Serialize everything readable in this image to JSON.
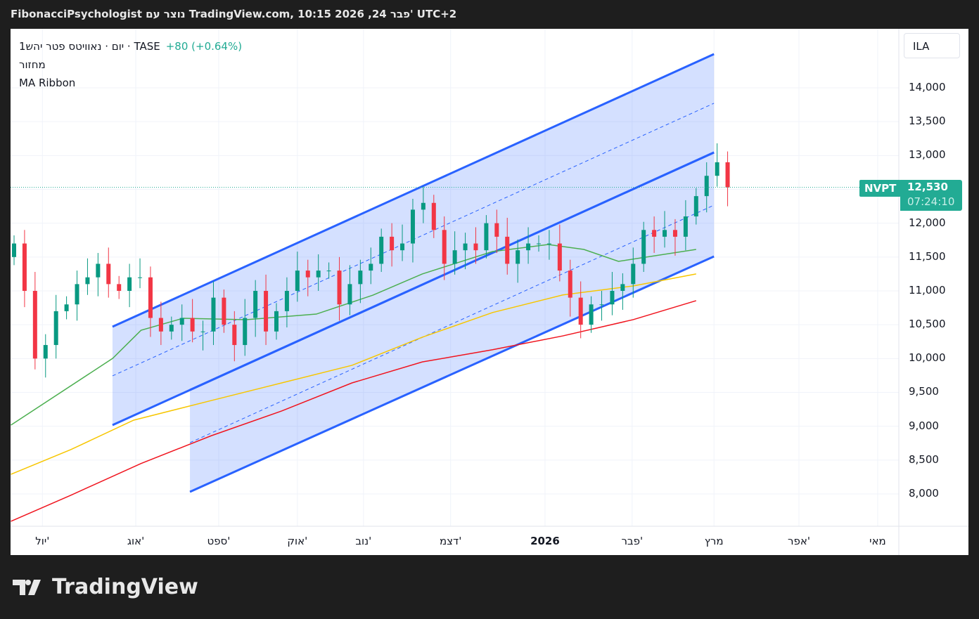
{
  "header": {
    "title": "FibonacciPsychologist נוצר עם TradingView.com, 10:15 2026 ,24 פבר' UTC+2"
  },
  "legend": {
    "symbol": "1יום · נאוויטס פטר יהש · TASE",
    "change": "+80 (+0.64%)",
    "indicator1": "מחזור",
    "indicator2": "MA Ribbon"
  },
  "currency": "ILA",
  "price_tag": {
    "symbol": "NVPT",
    "price": "12,530",
    "countdown": "07:24:10"
  },
  "brand": "TradingView",
  "colors": {
    "up": "#089981",
    "down": "#f23645",
    "ma1": "#4caf50",
    "ma2": "#f7c600",
    "ma3": "#f0141e",
    "channel": "#2962ff",
    "fill": "rgba(41,98,255,0.2)",
    "last": "#22ab94"
  },
  "chart_data": {
    "type": "candlestick",
    "title": "נאוויטס פטר יהש · 1יום · TASE",
    "ylim": [
      7600,
      14800
    ],
    "y_ticks": [
      "8,000",
      "8,500",
      "9,000",
      "9,500",
      "10,000",
      "10,500",
      "11,000",
      "11,500",
      "12,000",
      "12,500",
      "13,000",
      "13,500",
      "14,000"
    ],
    "y_tick_values": [
      8000,
      8500,
      9000,
      9500,
      10000,
      10500,
      11000,
      11500,
      12000,
      12500,
      13000,
      13500,
      14000
    ],
    "x_ticks": [
      {
        "label": "יול'",
        "i": 2.7,
        "bold": false
      },
      {
        "label": "אוג'",
        "i": 11.6,
        "bold": false
      },
      {
        "label": "ספט'",
        "i": 19.5,
        "bold": false
      },
      {
        "label": "אוק'",
        "i": 27.0,
        "bold": false
      },
      {
        "label": "נוב'",
        "i": 33.3,
        "bold": false
      },
      {
        "label": "דצמ'",
        "i": 41.6,
        "bold": false
      },
      {
        "label": "2026",
        "i": 50.6,
        "bold": true
      },
      {
        "label": "פבר'",
        "i": 58.9,
        "bold": false
      },
      {
        "label": "מרץ",
        "i": 66.7,
        "bold": false
      },
      {
        "label": "אפר'",
        "i": 74.8,
        "bold": false
      },
      {
        "label": "מאי",
        "i": 82.3,
        "bold": false
      }
    ],
    "closes": [
      11700,
      11000,
      10000,
      10200,
      10700,
      10800,
      11100,
      11200,
      11400,
      11100,
      11000,
      11200,
      11200,
      10600,
      10400,
      10500,
      10600,
      10400,
      10400,
      10900,
      10500,
      10200,
      10600,
      11000,
      10400,
      10700,
      11000,
      11300,
      11200,
      11300,
      11300,
      10800,
      11100,
      11300,
      11400,
      11800,
      11600,
      11700,
      12200,
      12300,
      11900,
      11400,
      11600,
      11700,
      11600,
      12000,
      11800,
      11400,
      11600,
      11700,
      11700,
      11700,
      11300,
      10900,
      10500,
      10800,
      10800,
      11000,
      11100,
      11400,
      11900,
      11800,
      11900,
      11800,
      12100,
      12400,
      12700,
      12900,
      12530
    ],
    "last_price": 12530,
    "ma_series": [
      {
        "name": "MA 50",
        "color": "#4caf50",
        "points": [
          [
            -0.3,
            9017
          ],
          [
            9.4,
            10003
          ],
          [
            12.1,
            10418
          ],
          [
            16.1,
            10595
          ],
          [
            22.1,
            10574
          ],
          [
            28.8,
            10657
          ],
          [
            34.2,
            10937
          ],
          [
            38.9,
            11250
          ],
          [
            45.6,
            11581
          ],
          [
            50.9,
            11685
          ],
          [
            54.3,
            11612
          ],
          [
            57.6,
            11436
          ],
          [
            65,
            11612
          ]
        ]
      },
      {
        "name": "MA 100",
        "color": "#f7c600",
        "points": [
          [
            -0.3,
            8290
          ],
          [
            5.4,
            8654
          ],
          [
            11.4,
            9090
          ],
          [
            18.8,
            9380
          ],
          [
            25.5,
            9640
          ],
          [
            32.2,
            9900
          ],
          [
            38.9,
            10315
          ],
          [
            45.6,
            10680
          ],
          [
            52.3,
            10940
          ],
          [
            59,
            11073
          ],
          [
            65,
            11250
          ]
        ]
      },
      {
        "name": "MA 200",
        "color": "#f0141e",
        "points": [
          [
            -0.3,
            7595
          ],
          [
            5.4,
            7980
          ],
          [
            12.1,
            8450
          ],
          [
            18.8,
            8860
          ],
          [
            25.5,
            9225
          ],
          [
            32.2,
            9640
          ],
          [
            38.9,
            9950
          ],
          [
            45.6,
            10130
          ],
          [
            52.3,
            10335
          ],
          [
            59,
            10575
          ],
          [
            65,
            10855
          ]
        ]
      }
    ],
    "channels": [
      {
        "top": [
          [
            9.38,
            10470
          ],
          [
            66.7,
            14498
          ]
        ],
        "mid": [
          [
            9.38,
            9744
          ],
          [
            66.7,
            13772
          ]
        ],
        "bottom": [
          [
            9.38,
            9017
          ],
          [
            66.7,
            13045
          ]
        ]
      },
      {
        "top": [
          [
            16.76,
            9536
          ],
          [
            66.7,
            13045
          ]
        ],
        "mid": [
          [
            16.76,
            8757
          ],
          [
            66.7,
            12266
          ]
        ],
        "bottom": [
          [
            16.76,
            8031
          ],
          [
            66.7,
            11509
          ]
        ]
      }
    ]
  }
}
